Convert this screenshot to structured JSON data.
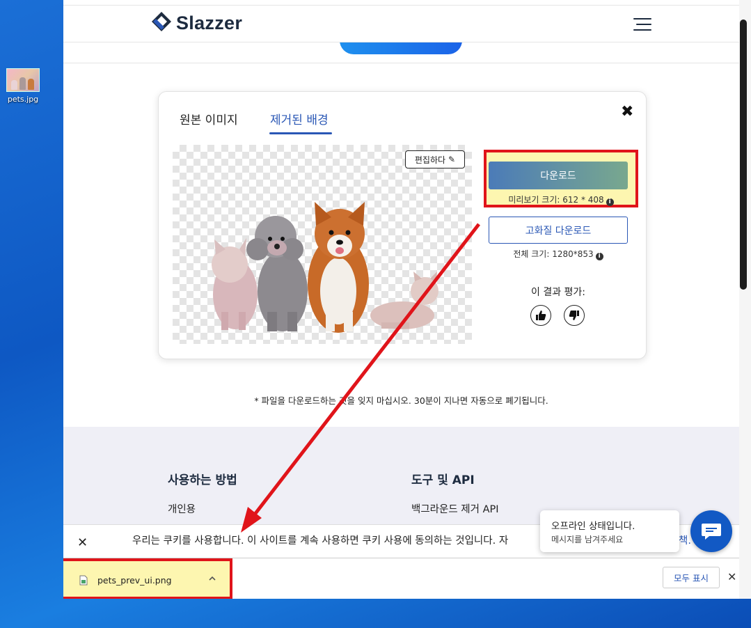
{
  "desktop": {
    "icon_label": "pets.jpg"
  },
  "header": {
    "brand": "Slazzer"
  },
  "result_card": {
    "tab_original": "원본 이미지",
    "tab_removed": "제거된 배경",
    "edit_label": "편집하다",
    "download_label": "다운로드",
    "preview_size_text": "미리보기 크기: 612 * 408",
    "hq_download_label": "고화질 다운로드",
    "full_size_text": "전체 크기: 1280*853",
    "rate_label": "이 결과 평가:"
  },
  "note": "* 파일을 다운로드하는 것을 잊지 마십시오. 30분이 지나면 자동으로 폐기됩니다.",
  "footer": {
    "col1_heading": "사용하는 방법",
    "col1_link": "개인용",
    "col2_heading": "도구 및 API",
    "col2_link": "백그라운드 제거 API"
  },
  "cookie": {
    "text": "우리는 쿠키를 사용합니다. 이 사이트를 계속 사용하면 쿠키 사용에 동의하는 것입니다. 자",
    "link_fragment": "책."
  },
  "chat": {
    "title": "오프라인 상태입니다.",
    "subtitle": "메시지를 남겨주세요"
  },
  "download_shelf": {
    "file_name": "pets_prev_ui.png",
    "show_all_label": "모두 표시"
  },
  "colors": {
    "highlight_red": "#e0141a",
    "highlight_fill": "#fdf6b0",
    "brand_blue": "#2a57b5",
    "chat_blue": "#1259c4"
  }
}
